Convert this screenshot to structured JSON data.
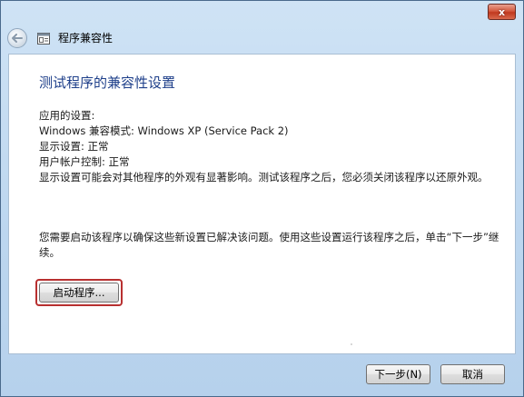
{
  "window": {
    "title": "程序兼容性",
    "close_glyph": "x"
  },
  "heading": "测试程序的兼容性设置",
  "settings": {
    "label": "应用的设置:",
    "compat_mode": "Windows 兼容模式: Windows XP (Service Pack 2)",
    "display": "显示设置: 正常",
    "uac": "用户帐户控制: 正常",
    "note": "显示设置可能会对其他程序的外观有显著影响。测试该程序之后，您必须关闭该程序以还原外观。"
  },
  "instruction": "您需要启动该程序以确保这些新设置已解决该问题。使用这些设置运行该程序之后，单击“下一步”继续。",
  "buttons": {
    "launch": "启动程序...",
    "next": "下一步(N)",
    "cancel": "取消"
  },
  "icons": {
    "back": "back-arrow-icon",
    "app": "program-compatibility-icon",
    "close": "close-icon"
  },
  "colors": {
    "heading": "#1e3f8a",
    "highlight": "#b83030",
    "close_button": "#c0391f"
  }
}
